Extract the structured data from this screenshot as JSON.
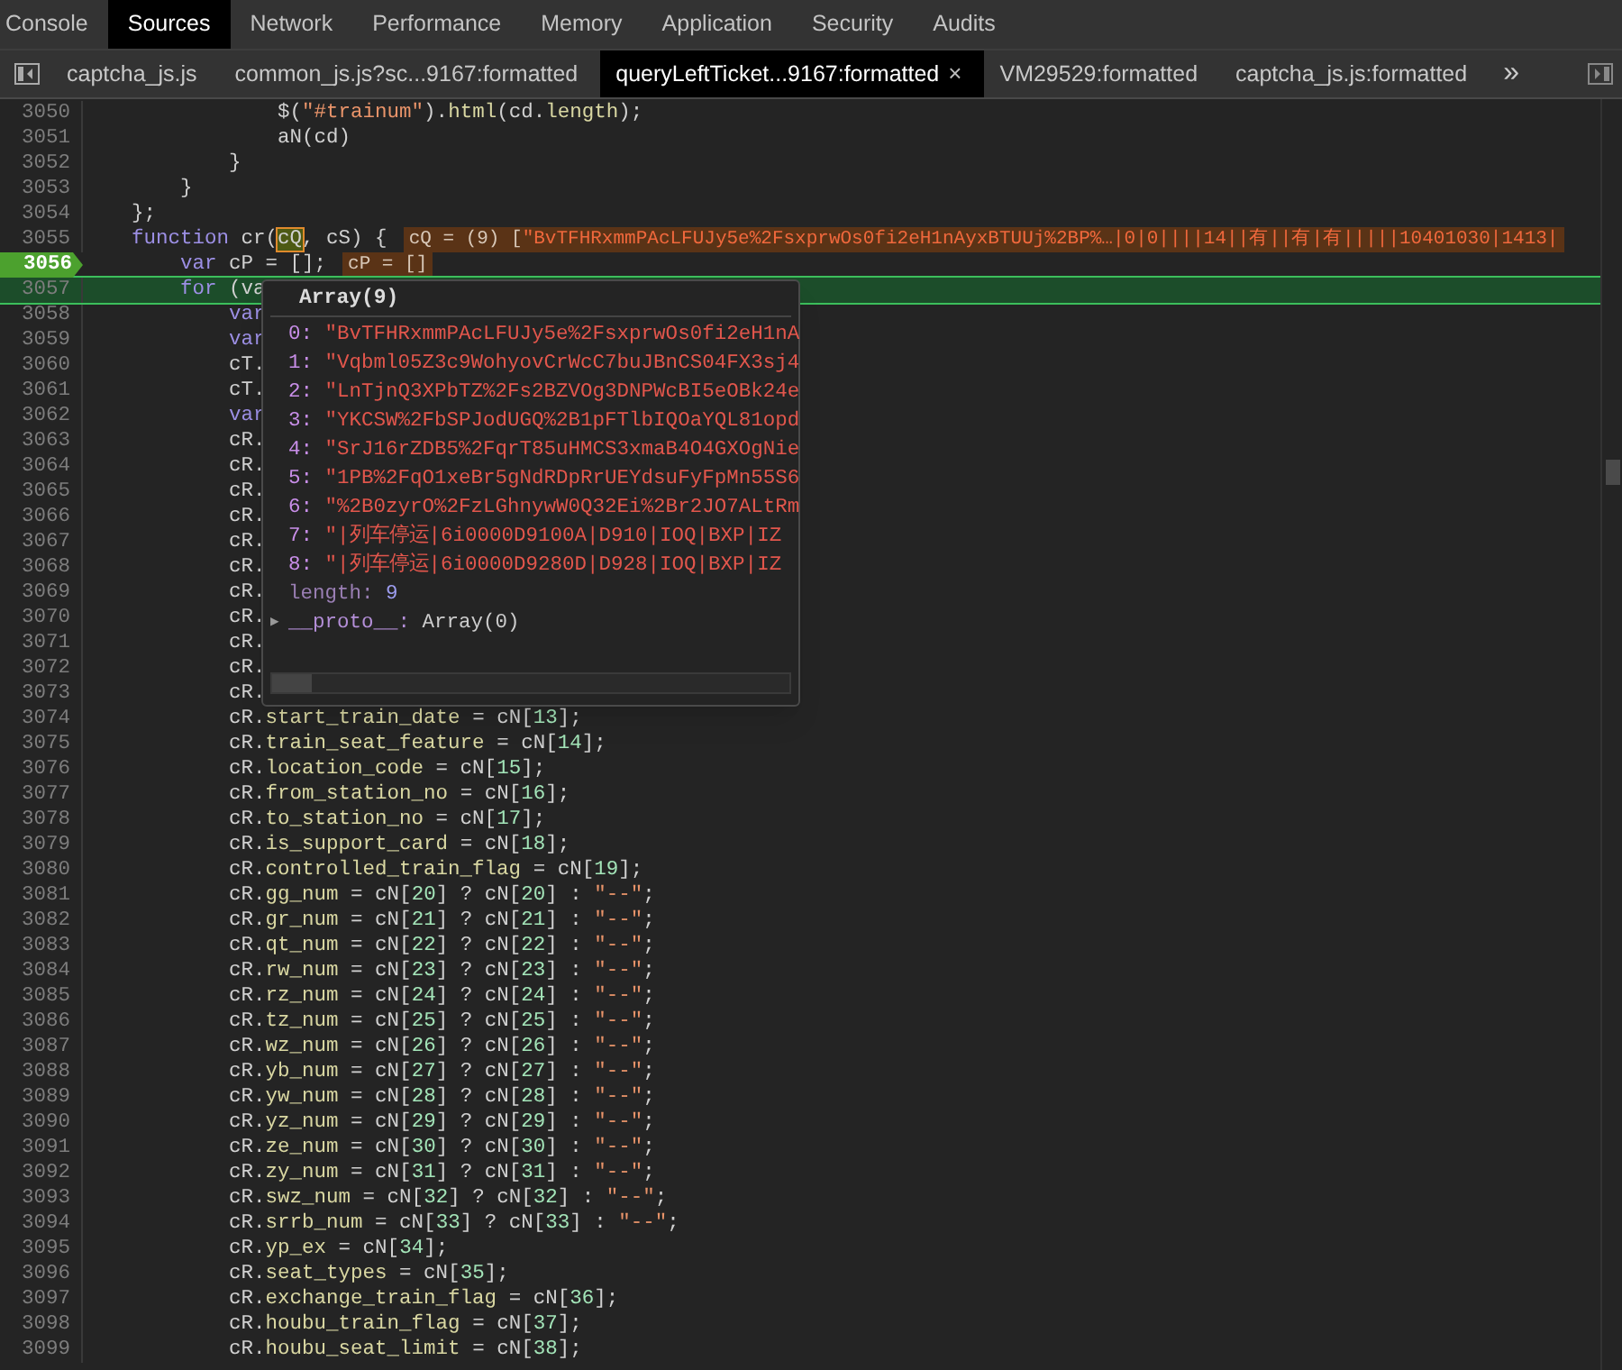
{
  "panel_tabs": [
    {
      "label": "Console",
      "selected": false
    },
    {
      "label": "Sources",
      "selected": true
    },
    {
      "label": "Network",
      "selected": false
    },
    {
      "label": "Performance",
      "selected": false
    },
    {
      "label": "Memory",
      "selected": false
    },
    {
      "label": "Application",
      "selected": false
    },
    {
      "label": "Security",
      "selected": false
    },
    {
      "label": "Audits",
      "selected": false
    }
  ],
  "file_tabs": [
    {
      "label": "captcha_js.js",
      "selected": false
    },
    {
      "label": "common_js.js?sc...9167:formatted",
      "selected": false
    },
    {
      "label": "queryLeftTicket...9167:formatted",
      "selected": true,
      "close": "×"
    },
    {
      "label": "VM29529:formatted",
      "selected": false
    },
    {
      "label": "captcha_js.js:formatted",
      "selected": false
    }
  ],
  "overflow_button": "»",
  "code_lines": [
    {
      "number": "3050",
      "breakpoint": false,
      "current": false,
      "tokens": [
        {
          "kind": "plain",
          "text": "                $("
        },
        {
          "kind": "str",
          "text": "\"#trainum\""
        },
        {
          "kind": "plain",
          "text": ")."
        },
        {
          "kind": "prop",
          "text": "html"
        },
        {
          "kind": "plain",
          "text": "(cd."
        },
        {
          "kind": "prop",
          "text": "length"
        },
        {
          "kind": "plain",
          "text": ");"
        }
      ]
    },
    {
      "number": "3051",
      "breakpoint": false,
      "current": false,
      "tokens": [
        {
          "kind": "plain",
          "text": "                aN(cd)"
        }
      ]
    },
    {
      "number": "3052",
      "breakpoint": false,
      "current": false,
      "tokens": [
        {
          "kind": "plain",
          "text": "            }"
        }
      ]
    },
    {
      "number": "3053",
      "breakpoint": false,
      "current": false,
      "tokens": [
        {
          "kind": "plain",
          "text": "        }"
        }
      ]
    },
    {
      "number": "3054",
      "breakpoint": false,
      "current": false,
      "tokens": [
        {
          "kind": "plain",
          "text": "    };"
        }
      ]
    },
    {
      "number": "3055",
      "breakpoint": false,
      "current": false,
      "tokens": [
        {
          "kind": "kw",
          "text": "    function"
        },
        {
          "kind": "plain",
          "text": " cr("
        },
        {
          "kind": "hl",
          "text": "cQ"
        },
        {
          "kind": "plain",
          "text": ", cS) {"
        }
      ],
      "inline_value": [
        {
          "kind": "plain",
          "text": "cQ = (9) ["
        },
        {
          "kind": "str",
          "text": "\"BvTFHRxmmPAcLFUJy5e%2FsxprwOs0fi2eH1nAyxBTUUj%2BP%…|0|0||||14||有||有|有|||||10401030|1413|"
        }
      ]
    },
    {
      "number": "3056",
      "breakpoint": true,
      "current": false,
      "tokens": [
        {
          "kind": "kw",
          "text": "        var"
        },
        {
          "kind": "plain",
          "text": " cP = [];"
        }
      ],
      "inline_value": [
        {
          "kind": "plain",
          "text": "cP = []"
        }
      ]
    },
    {
      "number": "3057",
      "breakpoint": false,
      "current": true,
      "tokens": [
        {
          "kind": "kw",
          "text": "        for"
        },
        {
          "kind": "plain",
          "text": " (va"
        }
      ]
    },
    {
      "number": "3058",
      "breakpoint": false,
      "current": false,
      "tokens": [
        {
          "kind": "kw",
          "text": "            var"
        }
      ]
    },
    {
      "number": "3059",
      "breakpoint": false,
      "current": false,
      "tokens": [
        {
          "kind": "kw",
          "text": "            var"
        }
      ]
    },
    {
      "number": "3060",
      "breakpoint": false,
      "current": false,
      "tokens": [
        {
          "kind": "plain",
          "text": "            cT."
        }
      ]
    },
    {
      "number": "3061",
      "breakpoint": false,
      "current": false,
      "tokens": [
        {
          "kind": "plain",
          "text": "            cT."
        }
      ]
    },
    {
      "number": "3062",
      "breakpoint": false,
      "current": false,
      "tokens": [
        {
          "kind": "kw",
          "text": "            var"
        }
      ]
    },
    {
      "number": "3063",
      "breakpoint": false,
      "current": false,
      "tokens": [
        {
          "kind": "plain",
          "text": "            cR."
        }
      ]
    },
    {
      "number": "3064",
      "breakpoint": false,
      "current": false,
      "tokens": [
        {
          "kind": "plain",
          "text": "            cR."
        }
      ]
    },
    {
      "number": "3065",
      "breakpoint": false,
      "current": false,
      "tokens": [
        {
          "kind": "plain",
          "text": "            cR."
        }
      ]
    },
    {
      "number": "3066",
      "breakpoint": false,
      "current": false,
      "tokens": [
        {
          "kind": "plain",
          "text": "            cR."
        }
      ]
    },
    {
      "number": "3067",
      "breakpoint": false,
      "current": false,
      "tokens": [
        {
          "kind": "plain",
          "text": "            cR."
        }
      ]
    },
    {
      "number": "3068",
      "breakpoint": false,
      "current": false,
      "tokens": [
        {
          "kind": "plain",
          "text": "            cR."
        }
      ]
    },
    {
      "number": "3069",
      "breakpoint": false,
      "current": false,
      "tokens": [
        {
          "kind": "plain",
          "text": "            cR."
        }
      ]
    },
    {
      "number": "3070",
      "breakpoint": false,
      "current": false,
      "tokens": [
        {
          "kind": "plain",
          "text": "            cR."
        }
      ]
    },
    {
      "number": "3071",
      "breakpoint": false,
      "current": false,
      "tokens": [
        {
          "kind": "plain",
          "text": "            cR."
        }
      ]
    },
    {
      "number": "3072",
      "breakpoint": false,
      "current": false,
      "tokens": [
        {
          "kind": "plain",
          "text": "            cR."
        }
      ]
    },
    {
      "number": "3073",
      "breakpoint": false,
      "current": false,
      "tokens": [
        {
          "kind": "plain",
          "text": "            cR."
        }
      ]
    },
    {
      "number": "3074",
      "breakpoint": false,
      "current": false,
      "tokens": [
        {
          "kind": "plain",
          "text": "            cR."
        },
        {
          "kind": "prop",
          "text": "start_train_date"
        },
        {
          "kind": "plain",
          "text": " = cN["
        },
        {
          "kind": "num",
          "text": "13"
        },
        {
          "kind": "plain",
          "text": "];"
        }
      ]
    },
    {
      "number": "3075",
      "breakpoint": false,
      "current": false,
      "tokens": [
        {
          "kind": "plain",
          "text": "            cR."
        },
        {
          "kind": "prop",
          "text": "train_seat_feature"
        },
        {
          "kind": "plain",
          "text": " = cN["
        },
        {
          "kind": "num",
          "text": "14"
        },
        {
          "kind": "plain",
          "text": "];"
        }
      ]
    },
    {
      "number": "3076",
      "breakpoint": false,
      "current": false,
      "tokens": [
        {
          "kind": "plain",
          "text": "            cR."
        },
        {
          "kind": "prop",
          "text": "location_code"
        },
        {
          "kind": "plain",
          "text": " = cN["
        },
        {
          "kind": "num",
          "text": "15"
        },
        {
          "kind": "plain",
          "text": "];"
        }
      ]
    },
    {
      "number": "3077",
      "breakpoint": false,
      "current": false,
      "tokens": [
        {
          "kind": "plain",
          "text": "            cR."
        },
        {
          "kind": "prop",
          "text": "from_station_no"
        },
        {
          "kind": "plain",
          "text": " = cN["
        },
        {
          "kind": "num",
          "text": "16"
        },
        {
          "kind": "plain",
          "text": "];"
        }
      ]
    },
    {
      "number": "3078",
      "breakpoint": false,
      "current": false,
      "tokens": [
        {
          "kind": "plain",
          "text": "            cR."
        },
        {
          "kind": "prop",
          "text": "to_station_no"
        },
        {
          "kind": "plain",
          "text": " = cN["
        },
        {
          "kind": "num",
          "text": "17"
        },
        {
          "kind": "plain",
          "text": "];"
        }
      ]
    },
    {
      "number": "3079",
      "breakpoint": false,
      "current": false,
      "tokens": [
        {
          "kind": "plain",
          "text": "            cR."
        },
        {
          "kind": "prop",
          "text": "is_support_card"
        },
        {
          "kind": "plain",
          "text": " = cN["
        },
        {
          "kind": "num",
          "text": "18"
        },
        {
          "kind": "plain",
          "text": "];"
        }
      ]
    },
    {
      "number": "3080",
      "breakpoint": false,
      "current": false,
      "tokens": [
        {
          "kind": "plain",
          "text": "            cR."
        },
        {
          "kind": "prop",
          "text": "controlled_train_flag"
        },
        {
          "kind": "plain",
          "text": " = cN["
        },
        {
          "kind": "num",
          "text": "19"
        },
        {
          "kind": "plain",
          "text": "];"
        }
      ]
    },
    {
      "number": "3081",
      "breakpoint": false,
      "current": false,
      "tokens": [
        {
          "kind": "plain",
          "text": "            cR."
        },
        {
          "kind": "prop",
          "text": "gg_num"
        },
        {
          "kind": "plain",
          "text": " = cN["
        },
        {
          "kind": "num",
          "text": "20"
        },
        {
          "kind": "plain",
          "text": "] ? cN["
        },
        {
          "kind": "num",
          "text": "20"
        },
        {
          "kind": "plain",
          "text": "] : "
        },
        {
          "kind": "str",
          "text": "\"--\""
        },
        {
          "kind": "plain",
          "text": ";"
        }
      ]
    },
    {
      "number": "3082",
      "breakpoint": false,
      "current": false,
      "tokens": [
        {
          "kind": "plain",
          "text": "            cR."
        },
        {
          "kind": "prop",
          "text": "gr_num"
        },
        {
          "kind": "plain",
          "text": " = cN["
        },
        {
          "kind": "num",
          "text": "21"
        },
        {
          "kind": "plain",
          "text": "] ? cN["
        },
        {
          "kind": "num",
          "text": "21"
        },
        {
          "kind": "plain",
          "text": "] : "
        },
        {
          "kind": "str",
          "text": "\"--\""
        },
        {
          "kind": "plain",
          "text": ";"
        }
      ]
    },
    {
      "number": "3083",
      "breakpoint": false,
      "current": false,
      "tokens": [
        {
          "kind": "plain",
          "text": "            cR."
        },
        {
          "kind": "prop",
          "text": "qt_num"
        },
        {
          "kind": "plain",
          "text": " = cN["
        },
        {
          "kind": "num",
          "text": "22"
        },
        {
          "kind": "plain",
          "text": "] ? cN["
        },
        {
          "kind": "num",
          "text": "22"
        },
        {
          "kind": "plain",
          "text": "] : "
        },
        {
          "kind": "str",
          "text": "\"--\""
        },
        {
          "kind": "plain",
          "text": ";"
        }
      ]
    },
    {
      "number": "3084",
      "breakpoint": false,
      "current": false,
      "tokens": [
        {
          "kind": "plain",
          "text": "            cR."
        },
        {
          "kind": "prop",
          "text": "rw_num"
        },
        {
          "kind": "plain",
          "text": " = cN["
        },
        {
          "kind": "num",
          "text": "23"
        },
        {
          "kind": "plain",
          "text": "] ? cN["
        },
        {
          "kind": "num",
          "text": "23"
        },
        {
          "kind": "plain",
          "text": "] : "
        },
        {
          "kind": "str",
          "text": "\"--\""
        },
        {
          "kind": "plain",
          "text": ";"
        }
      ]
    },
    {
      "number": "3085",
      "breakpoint": false,
      "current": false,
      "tokens": [
        {
          "kind": "plain",
          "text": "            cR."
        },
        {
          "kind": "prop",
          "text": "rz_num"
        },
        {
          "kind": "plain",
          "text": " = cN["
        },
        {
          "kind": "num",
          "text": "24"
        },
        {
          "kind": "plain",
          "text": "] ? cN["
        },
        {
          "kind": "num",
          "text": "24"
        },
        {
          "kind": "plain",
          "text": "] : "
        },
        {
          "kind": "str",
          "text": "\"--\""
        },
        {
          "kind": "plain",
          "text": ";"
        }
      ]
    },
    {
      "number": "3086",
      "breakpoint": false,
      "current": false,
      "tokens": [
        {
          "kind": "plain",
          "text": "            cR."
        },
        {
          "kind": "prop",
          "text": "tz_num"
        },
        {
          "kind": "plain",
          "text": " = cN["
        },
        {
          "kind": "num",
          "text": "25"
        },
        {
          "kind": "plain",
          "text": "] ? cN["
        },
        {
          "kind": "num",
          "text": "25"
        },
        {
          "kind": "plain",
          "text": "] : "
        },
        {
          "kind": "str",
          "text": "\"--\""
        },
        {
          "kind": "plain",
          "text": ";"
        }
      ]
    },
    {
      "number": "3087",
      "breakpoint": false,
      "current": false,
      "tokens": [
        {
          "kind": "plain",
          "text": "            cR."
        },
        {
          "kind": "prop",
          "text": "wz_num"
        },
        {
          "kind": "plain",
          "text": " = cN["
        },
        {
          "kind": "num",
          "text": "26"
        },
        {
          "kind": "plain",
          "text": "] ? cN["
        },
        {
          "kind": "num",
          "text": "26"
        },
        {
          "kind": "plain",
          "text": "] : "
        },
        {
          "kind": "str",
          "text": "\"--\""
        },
        {
          "kind": "plain",
          "text": ";"
        }
      ]
    },
    {
      "number": "3088",
      "breakpoint": false,
      "current": false,
      "tokens": [
        {
          "kind": "plain",
          "text": "            cR."
        },
        {
          "kind": "prop",
          "text": "yb_num"
        },
        {
          "kind": "plain",
          "text": " = cN["
        },
        {
          "kind": "num",
          "text": "27"
        },
        {
          "kind": "plain",
          "text": "] ? cN["
        },
        {
          "kind": "num",
          "text": "27"
        },
        {
          "kind": "plain",
          "text": "] : "
        },
        {
          "kind": "str",
          "text": "\"--\""
        },
        {
          "kind": "plain",
          "text": ";"
        }
      ]
    },
    {
      "number": "3089",
      "breakpoint": false,
      "current": false,
      "tokens": [
        {
          "kind": "plain",
          "text": "            cR."
        },
        {
          "kind": "prop",
          "text": "yw_num"
        },
        {
          "kind": "plain",
          "text": " = cN["
        },
        {
          "kind": "num",
          "text": "28"
        },
        {
          "kind": "plain",
          "text": "] ? cN["
        },
        {
          "kind": "num",
          "text": "28"
        },
        {
          "kind": "plain",
          "text": "] : "
        },
        {
          "kind": "str",
          "text": "\"--\""
        },
        {
          "kind": "plain",
          "text": ";"
        }
      ]
    },
    {
      "number": "3090",
      "breakpoint": false,
      "current": false,
      "tokens": [
        {
          "kind": "plain",
          "text": "            cR."
        },
        {
          "kind": "prop",
          "text": "yz_num"
        },
        {
          "kind": "plain",
          "text": " = cN["
        },
        {
          "kind": "num",
          "text": "29"
        },
        {
          "kind": "plain",
          "text": "] ? cN["
        },
        {
          "kind": "num",
          "text": "29"
        },
        {
          "kind": "plain",
          "text": "] : "
        },
        {
          "kind": "str",
          "text": "\"--\""
        },
        {
          "kind": "plain",
          "text": ";"
        }
      ]
    },
    {
      "number": "3091",
      "breakpoint": false,
      "current": false,
      "tokens": [
        {
          "kind": "plain",
          "text": "            cR."
        },
        {
          "kind": "prop",
          "text": "ze_num"
        },
        {
          "kind": "plain",
          "text": " = cN["
        },
        {
          "kind": "num",
          "text": "30"
        },
        {
          "kind": "plain",
          "text": "] ? cN["
        },
        {
          "kind": "num",
          "text": "30"
        },
        {
          "kind": "plain",
          "text": "] : "
        },
        {
          "kind": "str",
          "text": "\"--\""
        },
        {
          "kind": "plain",
          "text": ";"
        }
      ]
    },
    {
      "number": "3092",
      "breakpoint": false,
      "current": false,
      "tokens": [
        {
          "kind": "plain",
          "text": "            cR."
        },
        {
          "kind": "prop",
          "text": "zy_num"
        },
        {
          "kind": "plain",
          "text": " = cN["
        },
        {
          "kind": "num",
          "text": "31"
        },
        {
          "kind": "plain",
          "text": "] ? cN["
        },
        {
          "kind": "num",
          "text": "31"
        },
        {
          "kind": "plain",
          "text": "] : "
        },
        {
          "kind": "str",
          "text": "\"--\""
        },
        {
          "kind": "plain",
          "text": ";"
        }
      ]
    },
    {
      "number": "3093",
      "breakpoint": false,
      "current": false,
      "tokens": [
        {
          "kind": "plain",
          "text": "            cR."
        },
        {
          "kind": "prop",
          "text": "swz_num"
        },
        {
          "kind": "plain",
          "text": " = cN["
        },
        {
          "kind": "num",
          "text": "32"
        },
        {
          "kind": "plain",
          "text": "] ? cN["
        },
        {
          "kind": "num",
          "text": "32"
        },
        {
          "kind": "plain",
          "text": "] : "
        },
        {
          "kind": "str",
          "text": "\"--\""
        },
        {
          "kind": "plain",
          "text": ";"
        }
      ]
    },
    {
      "number": "3094",
      "breakpoint": false,
      "current": false,
      "tokens": [
        {
          "kind": "plain",
          "text": "            cR."
        },
        {
          "kind": "prop",
          "text": "srrb_num"
        },
        {
          "kind": "plain",
          "text": " = cN["
        },
        {
          "kind": "num",
          "text": "33"
        },
        {
          "kind": "plain",
          "text": "] ? cN["
        },
        {
          "kind": "num",
          "text": "33"
        },
        {
          "kind": "plain",
          "text": "] : "
        },
        {
          "kind": "str",
          "text": "\"--\""
        },
        {
          "kind": "plain",
          "text": ";"
        }
      ]
    },
    {
      "number": "3095",
      "breakpoint": false,
      "current": false,
      "tokens": [
        {
          "kind": "plain",
          "text": "            cR."
        },
        {
          "kind": "prop",
          "text": "yp_ex"
        },
        {
          "kind": "plain",
          "text": " = cN["
        },
        {
          "kind": "num",
          "text": "34"
        },
        {
          "kind": "plain",
          "text": "];"
        }
      ]
    },
    {
      "number": "3096",
      "breakpoint": false,
      "current": false,
      "tokens": [
        {
          "kind": "plain",
          "text": "            cR."
        },
        {
          "kind": "prop",
          "text": "seat_types"
        },
        {
          "kind": "plain",
          "text": " = cN["
        },
        {
          "kind": "num",
          "text": "35"
        },
        {
          "kind": "plain",
          "text": "];"
        }
      ]
    },
    {
      "number": "3097",
      "breakpoint": false,
      "current": false,
      "tokens": [
        {
          "kind": "plain",
          "text": "            cR."
        },
        {
          "kind": "prop",
          "text": "exchange_train_flag"
        },
        {
          "kind": "plain",
          "text": " = cN["
        },
        {
          "kind": "num",
          "text": "36"
        },
        {
          "kind": "plain",
          "text": "];"
        }
      ]
    },
    {
      "number": "3098",
      "breakpoint": false,
      "current": false,
      "tokens": [
        {
          "kind": "plain",
          "text": "            cR."
        },
        {
          "kind": "prop",
          "text": "houbu_train_flag"
        },
        {
          "kind": "plain",
          "text": " = cN["
        },
        {
          "kind": "num",
          "text": "37"
        },
        {
          "kind": "plain",
          "text": "];"
        }
      ]
    },
    {
      "number": "3099",
      "breakpoint": false,
      "current": false,
      "tokens": [
        {
          "kind": "plain",
          "text": "            cR."
        },
        {
          "kind": "prop",
          "text": "houbu_seat_limit"
        },
        {
          "kind": "plain",
          "text": " = cN["
        },
        {
          "kind": "num",
          "text": "38"
        },
        {
          "kind": "plain",
          "text": "];"
        }
      ]
    }
  ],
  "popup": {
    "title": "Array(9)",
    "entries": [
      {
        "key": "0:",
        "value": "\"BvTFHRxmmPAcLFUJy5e%2FsxprwOs0fi2eH1nA"
      },
      {
        "key": "1:",
        "value": "\"Vqbml05Z3c9WohyovCrWcC7buJBnCS04FX3sj4"
      },
      {
        "key": "2:",
        "value": "\"LnTjnQ3XPbTZ%2Fs2BZVOg3DNPWcBI5eOBk24e"
      },
      {
        "key": "3:",
        "value": "\"YKCSW%2FbSPJodUGQ%2B1pFTlbIQOaYQL81opd"
      },
      {
        "key": "4:",
        "value": "\"SrJ16rZDB5%2FqrT85uHMCS3xmaB4O4GXOgNie"
      },
      {
        "key": "5:",
        "value": "\"1PB%2FqO1xeBr5gNdRDpRrUEYdsuFyFpMn55S6"
      },
      {
        "key": "6:",
        "value": "\"%2B0zyrO%2FzLGhnywW0Q32Ei%2Br2JO7ALtRm"
      },
      {
        "key": "7:",
        "value": "\"|列车停运|6i0000D9100A|D910|IOQ|BXP|IZ"
      },
      {
        "key": "8:",
        "value": "\"|列车停运|6i0000D9280D|D928|IOQ|BXP|IZ"
      }
    ],
    "length": {
      "key": "length:",
      "value": "9"
    },
    "proto": {
      "toggle": "▶",
      "key": "__proto__:",
      "value": "Array(0)",
      "expanded": false
    }
  }
}
